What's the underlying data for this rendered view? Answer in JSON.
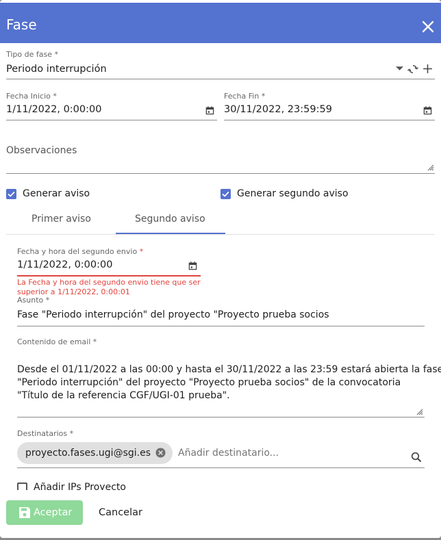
{
  "dialog": {
    "title": "Fase"
  },
  "tipo_fase": {
    "label": "Tipo de fase",
    "value": "Periodo interrupción"
  },
  "fecha_inicio": {
    "label": "Fecha Inicio",
    "value": "1/11/2022, 0:00:00"
  },
  "fecha_fin": {
    "label": "Fecha Fin",
    "value": "30/11/2022, 23:59:59"
  },
  "observaciones": {
    "label": "Observaciones",
    "value": ""
  },
  "checkboxes": {
    "generar_aviso": {
      "label": "Generar aviso",
      "checked": true
    },
    "generar_segundo_aviso": {
      "label": "Generar segundo aviso",
      "checked": true
    },
    "anadir_ips": {
      "label": "Añadir IPs Proyecto",
      "checked": false
    }
  },
  "tabs": [
    {
      "label": "Primer aviso",
      "active": false
    },
    {
      "label": "Segundo aviso",
      "active": true
    }
  ],
  "segundo_envio": {
    "label": "Fecha y hora del segundo envio",
    "value": "1/11/2022, 0:00:00",
    "error_line1": "La Fecha y hora del segundo envio tiene que ser",
    "error_line2": "superior a 1/11/2022, 0:00:01"
  },
  "asunto": {
    "label": "Asunto",
    "value": "Fase \"Periodo interrupción\" del proyecto \"Proyecto prueba socios"
  },
  "contenido": {
    "label": "Contenido de email",
    "lines": [
      "Desde el 01/11/2022 a las 00:00 y hasta el 30/11/2022 a las 23:59 estará abierta la fase",
      "\"Periodo interrupción\" del proyecto \"Proyecto prueba socios\" de la convocatoria",
      "\"Título de la referencia CGF/UGI-01 prueba\"."
    ]
  },
  "destinatarios": {
    "label": "Destinatarios",
    "chips": [
      "proyecto.fases.ugi@sgi.es"
    ],
    "placeholder": "Añadir destinatario..."
  },
  "required_mark": "*",
  "buttons": {
    "accept": "Aceptar",
    "cancel": "Cancelar"
  },
  "colors": {
    "header": "#5472cf",
    "accent": "#5472cf",
    "error": "#e0443d",
    "accept_disabled": "#8fd99a"
  },
  "icons": [
    "close-icon",
    "dropdown-arrow-icon",
    "refresh-icon",
    "add-icon",
    "calendar-icon",
    "resize-handle-icon",
    "chip-remove-icon",
    "search-icon",
    "save-icon",
    "check-icon"
  ]
}
